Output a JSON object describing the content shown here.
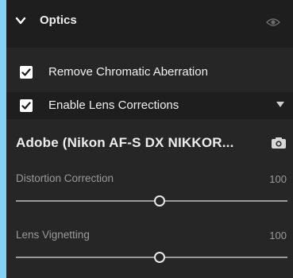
{
  "section": {
    "title": "Optics",
    "icons": {
      "collapse": "chevron-down-icon",
      "visibility": "eye-icon"
    }
  },
  "options": [
    {
      "label": "Remove Chromatic Aberration",
      "checked": true
    },
    {
      "label": "Enable Lens Corrections",
      "checked": true
    }
  ],
  "profile": {
    "name": "Adobe (Nikon AF-S DX NIKKOR...",
    "icon": "camera-icon"
  },
  "sliders": [
    {
      "label": "Distortion Correction",
      "value": "100",
      "fraction": 0.53
    },
    {
      "label": "Lens Vignetting",
      "value": "100",
      "fraction": 0.53
    }
  ],
  "colors": {
    "panel": "#262626",
    "header": "#1e1e1e",
    "background": "#86d0f5"
  }
}
